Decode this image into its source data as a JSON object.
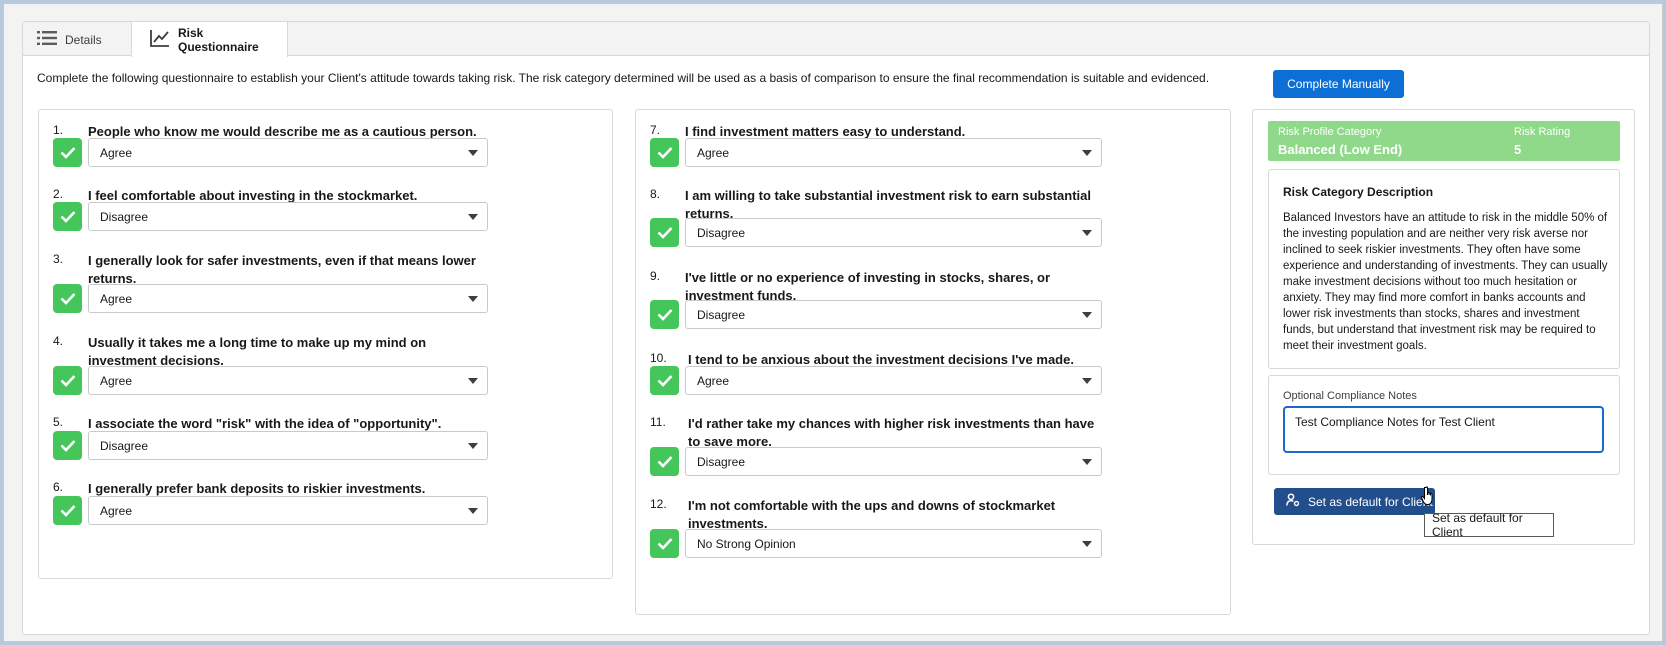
{
  "tabs": [
    {
      "label": "Details",
      "icon": "list-icon"
    },
    {
      "label": "Risk Questionnaire",
      "icon": "chart-line-icon"
    }
  ],
  "intro": "Complete the following questionnaire to establish your Client's attitude towards taking risk. The risk category determined will be used as a basis of comparison to ensure the final recommendation is suitable and evidenced.",
  "complete_manually_label": "Complete Manually",
  "questions": [
    {
      "num": "1.",
      "text": "People who know me would describe me as a cautious person.",
      "answer": "Agree"
    },
    {
      "num": "2.",
      "text": "I feel comfortable about investing in the stockmarket.",
      "answer": "Disagree"
    },
    {
      "num": "3.",
      "text": "I generally look for safer investments, even if that means lower returns.",
      "answer": "Agree"
    },
    {
      "num": "4.",
      "text": "Usually it takes me a long time to make up my mind on investment decisions.",
      "answer": "Agree"
    },
    {
      "num": "5.",
      "text": "I associate the word \"risk\" with the idea of \"opportunity\".",
      "answer": "Disagree"
    },
    {
      "num": "6.",
      "text": "I generally prefer bank deposits to riskier investments.",
      "answer": "Agree"
    },
    {
      "num": "7.",
      "text": "I find investment matters easy to understand.",
      "answer": "Agree"
    },
    {
      "num": "8.",
      "text": "I am willing to take substantial investment risk to earn substantial returns.",
      "answer": "Disagree"
    },
    {
      "num": "9.",
      "text": "I've little or no experience of investing in stocks, shares, or investment funds.",
      "answer": "Disagree"
    },
    {
      "num": "10.",
      "text": "I tend to be anxious about the investment decisions I've made.",
      "answer": "Agree"
    },
    {
      "num": "11.",
      "text": "I'd rather take my chances with higher risk investments than have to save more.",
      "answer": "Disagree"
    },
    {
      "num": "12.",
      "text": "I'm not comfortable with the ups and downs of stockmarket investments.",
      "answer": "No Strong Opinion"
    }
  ],
  "risk": {
    "category_label": "Risk Profile Category",
    "category_value": "Balanced (Low End)",
    "rating_label": "Risk Rating",
    "rating_value": "5",
    "color": "#90d98a"
  },
  "description": {
    "title": "Risk Category Description",
    "body": "Balanced Investors have an attitude to risk in the middle 50% of the investing population and are neither very risk averse nor inclined to seek riskier investments. They often have some experience and understanding of investments. They can usually make investment decisions without too much hesitation or anxiety. They may find more comfort in banks accounts and lower risk investments than stocks, shares and investment funds, but understand that investment risk may be required to meet their investment goals."
  },
  "notes": {
    "label": "Optional Compliance Notes",
    "value": "Test Compliance Notes for Test Client"
  },
  "set_default_label": "Set as default for Client",
  "tooltip": "Set as default for Client"
}
